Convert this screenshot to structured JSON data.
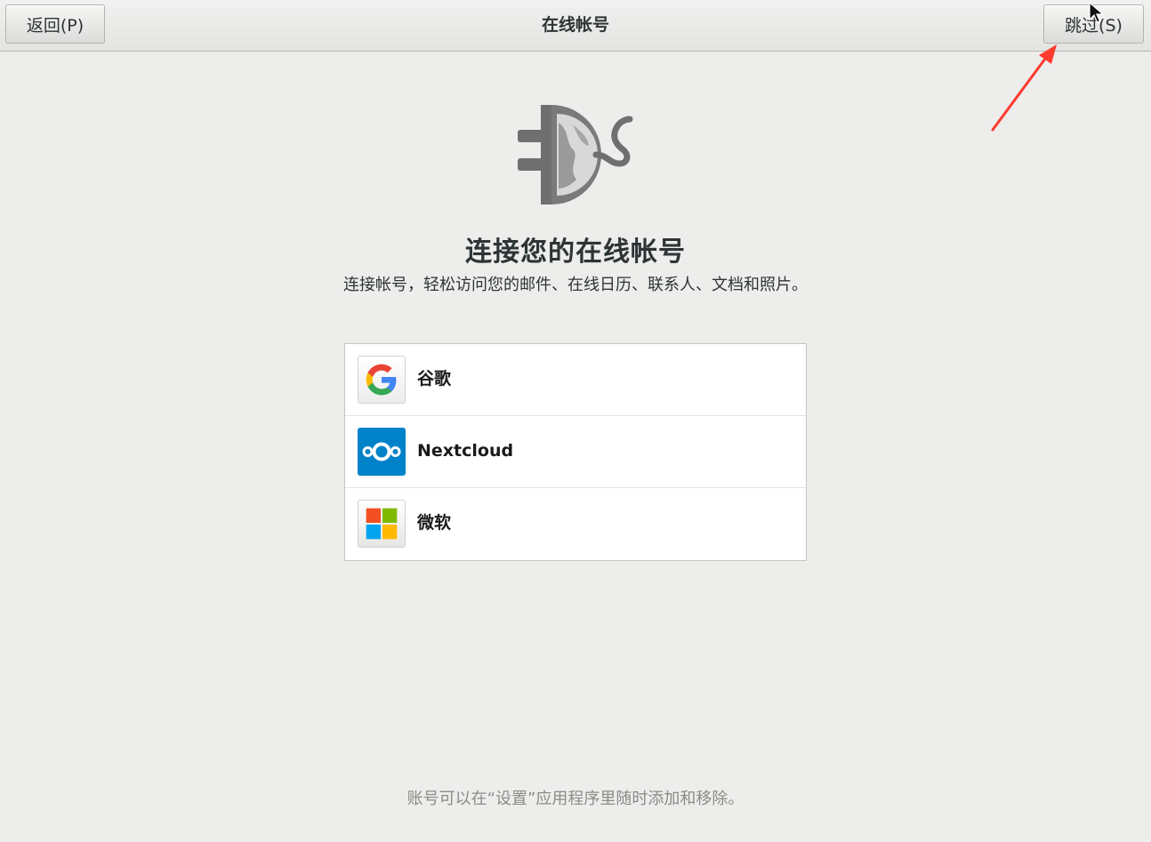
{
  "header": {
    "title": "在线帐号",
    "back_label": "返回(P)",
    "skip_label": "跳过(S)"
  },
  "hero": {
    "icon": "plug-globe-icon",
    "title": "连接您的在线帐号",
    "subtitle": "连接帐号，轻松访问您的邮件、在线日历、联系人、文档和照片。"
  },
  "providers": [
    {
      "label": "谷歌",
      "icon": "google-icon"
    },
    {
      "label": "Nextcloud",
      "icon": "nextcloud-icon"
    },
    {
      "label": "微软",
      "icon": "microsoft-icon"
    }
  ],
  "footer": {
    "note": "账号可以在“设置”应用程序里随时添加和移除。"
  },
  "colors": {
    "background": "#ededec",
    "list_background": "#ffffff",
    "annotation_arrow": "#ff3b30",
    "nextcloud_blue": "#0082c9"
  }
}
